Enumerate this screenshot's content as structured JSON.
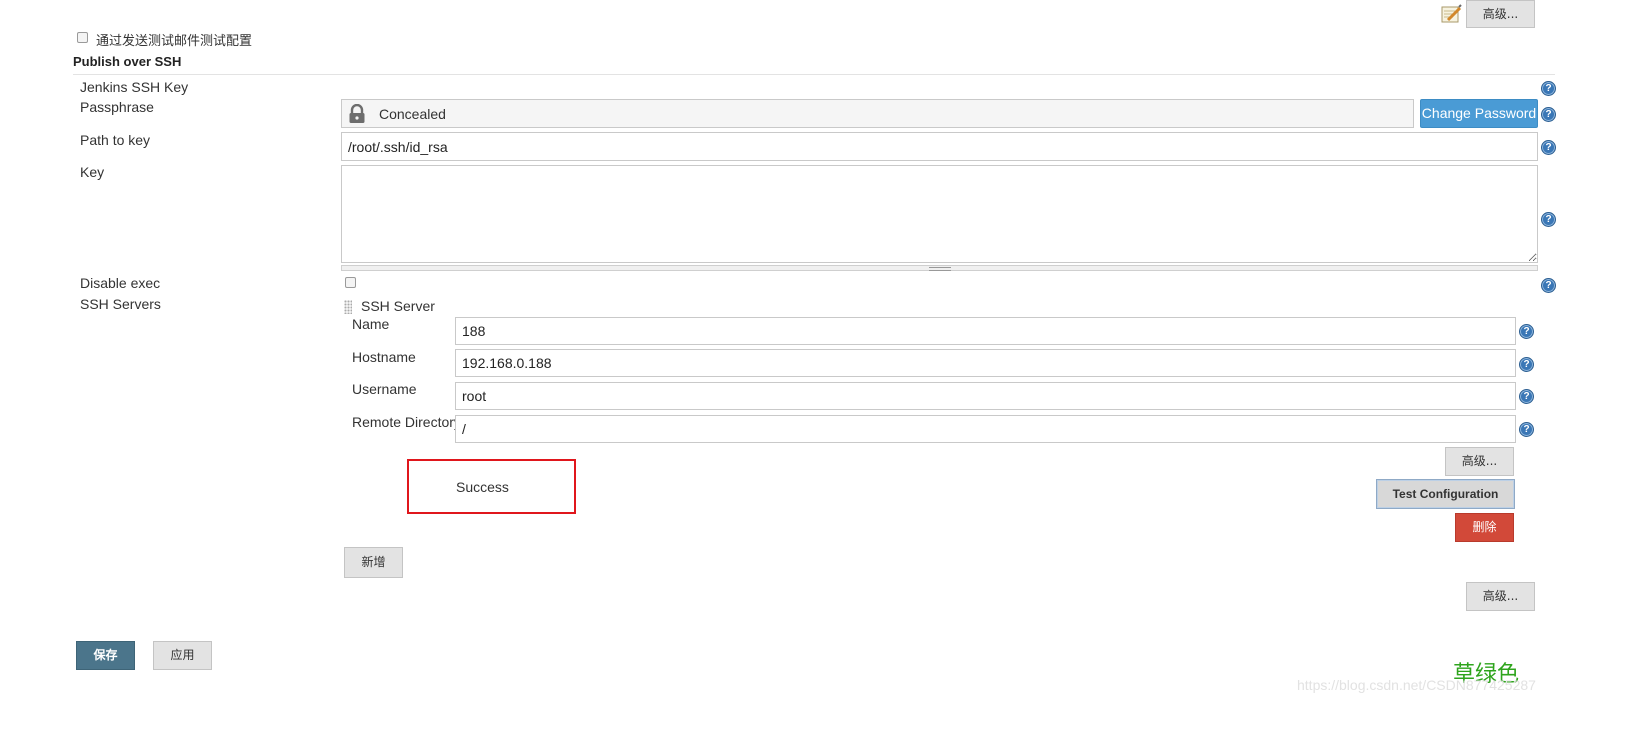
{
  "top": {
    "advanced_label": "高级...",
    "email_test_label": "通过发送测试邮件测试配置"
  },
  "section": {
    "title": "Publish over SSH"
  },
  "fields": {
    "jenkins_ssh_key_label": "Jenkins SSH Key",
    "passphrase_label": "Passphrase",
    "passphrase_value": "Concealed",
    "change_password_label": "Change Password",
    "path_to_key_label": "Path to key",
    "path_to_key_value": "/root/.ssh/id_rsa",
    "key_label": "Key",
    "key_value": "",
    "disable_exec_label": "Disable exec",
    "ssh_servers_label": "SSH Servers"
  },
  "ssh_server": {
    "header": "SSH Server",
    "name_label": "Name",
    "name_value": "188",
    "hostname_label": "Hostname",
    "hostname_value": "192.168.0.188",
    "username_label": "Username",
    "username_value": "root",
    "remote_dir_label": "Remote Directory",
    "remote_dir_value": "/",
    "advanced_label": "高级...",
    "status": "Success",
    "test_config_label": "Test Configuration",
    "delete_label": "删除"
  },
  "add_label": "新增",
  "bottom_advanced_label": "高级...",
  "footer": {
    "save_label": "保存",
    "apply_label": "应用"
  },
  "watermark": {
    "text": "草绿色",
    "url": "https://blog.csdn.net/CSDN877425287"
  },
  "colors": {
    "primary_blue": "#4a9bd5",
    "save_blue": "#4b758b",
    "delete_red": "#d24939",
    "highlight_red": "#e0161c",
    "watermark_green": "#2ea41c"
  },
  "icons": {
    "top_edit": "notepad-pencil-icon",
    "lock": "lock-icon",
    "help": "help-question-icon",
    "drag": "drag-handle-icon"
  }
}
